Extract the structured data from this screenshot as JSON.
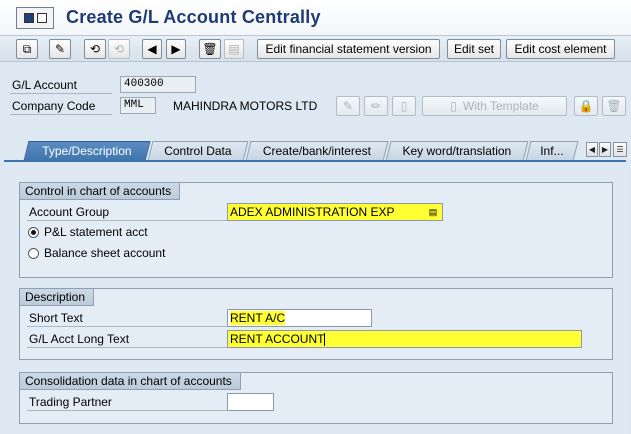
{
  "window": {
    "title": "Create G/L Account Centrally"
  },
  "toolbar": {
    "edit_fs_version": "Edit financial statement version",
    "edit_set": "Edit set",
    "edit_cost_element": "Edit cost element"
  },
  "header": {
    "gl_account_label": "G/L Account",
    "gl_account_value": "400300",
    "company_code_label": "Company Code",
    "company_code_value": "MML",
    "company_name": "MAHINDRA MOTORS LTD",
    "with_template": "With Template"
  },
  "tabs": [
    {
      "label": "Type/Description",
      "active": true
    },
    {
      "label": "Control Data",
      "active": false
    },
    {
      "label": "Create/bank/interest",
      "active": false
    },
    {
      "label": "Key word/translation",
      "active": false
    },
    {
      "label": "Inf...",
      "active": false
    }
  ],
  "control_group": {
    "title": "Control in chart of accounts",
    "account_group_label": "Account Group",
    "account_group_value": "ADEX ADMINISTRATION EXP",
    "pl_label": "P&L statement acct",
    "bs_label": "Balance sheet account",
    "selected": "pl"
  },
  "description_group": {
    "title": "Description",
    "short_text_label": "Short Text",
    "short_text_value": "RENT A/C",
    "long_text_label": "G/L Acct Long Text",
    "long_text_value": "RENT ACCOUNT"
  },
  "consolidation_group": {
    "title": "Consolidation data in chart of accounts",
    "trading_partner_label": "Trading Partner",
    "trading_partner_value": ""
  },
  "colors": {
    "title": "#1e3b73",
    "active_tab": "#3f74ad",
    "highlight": "#ffff33"
  }
}
